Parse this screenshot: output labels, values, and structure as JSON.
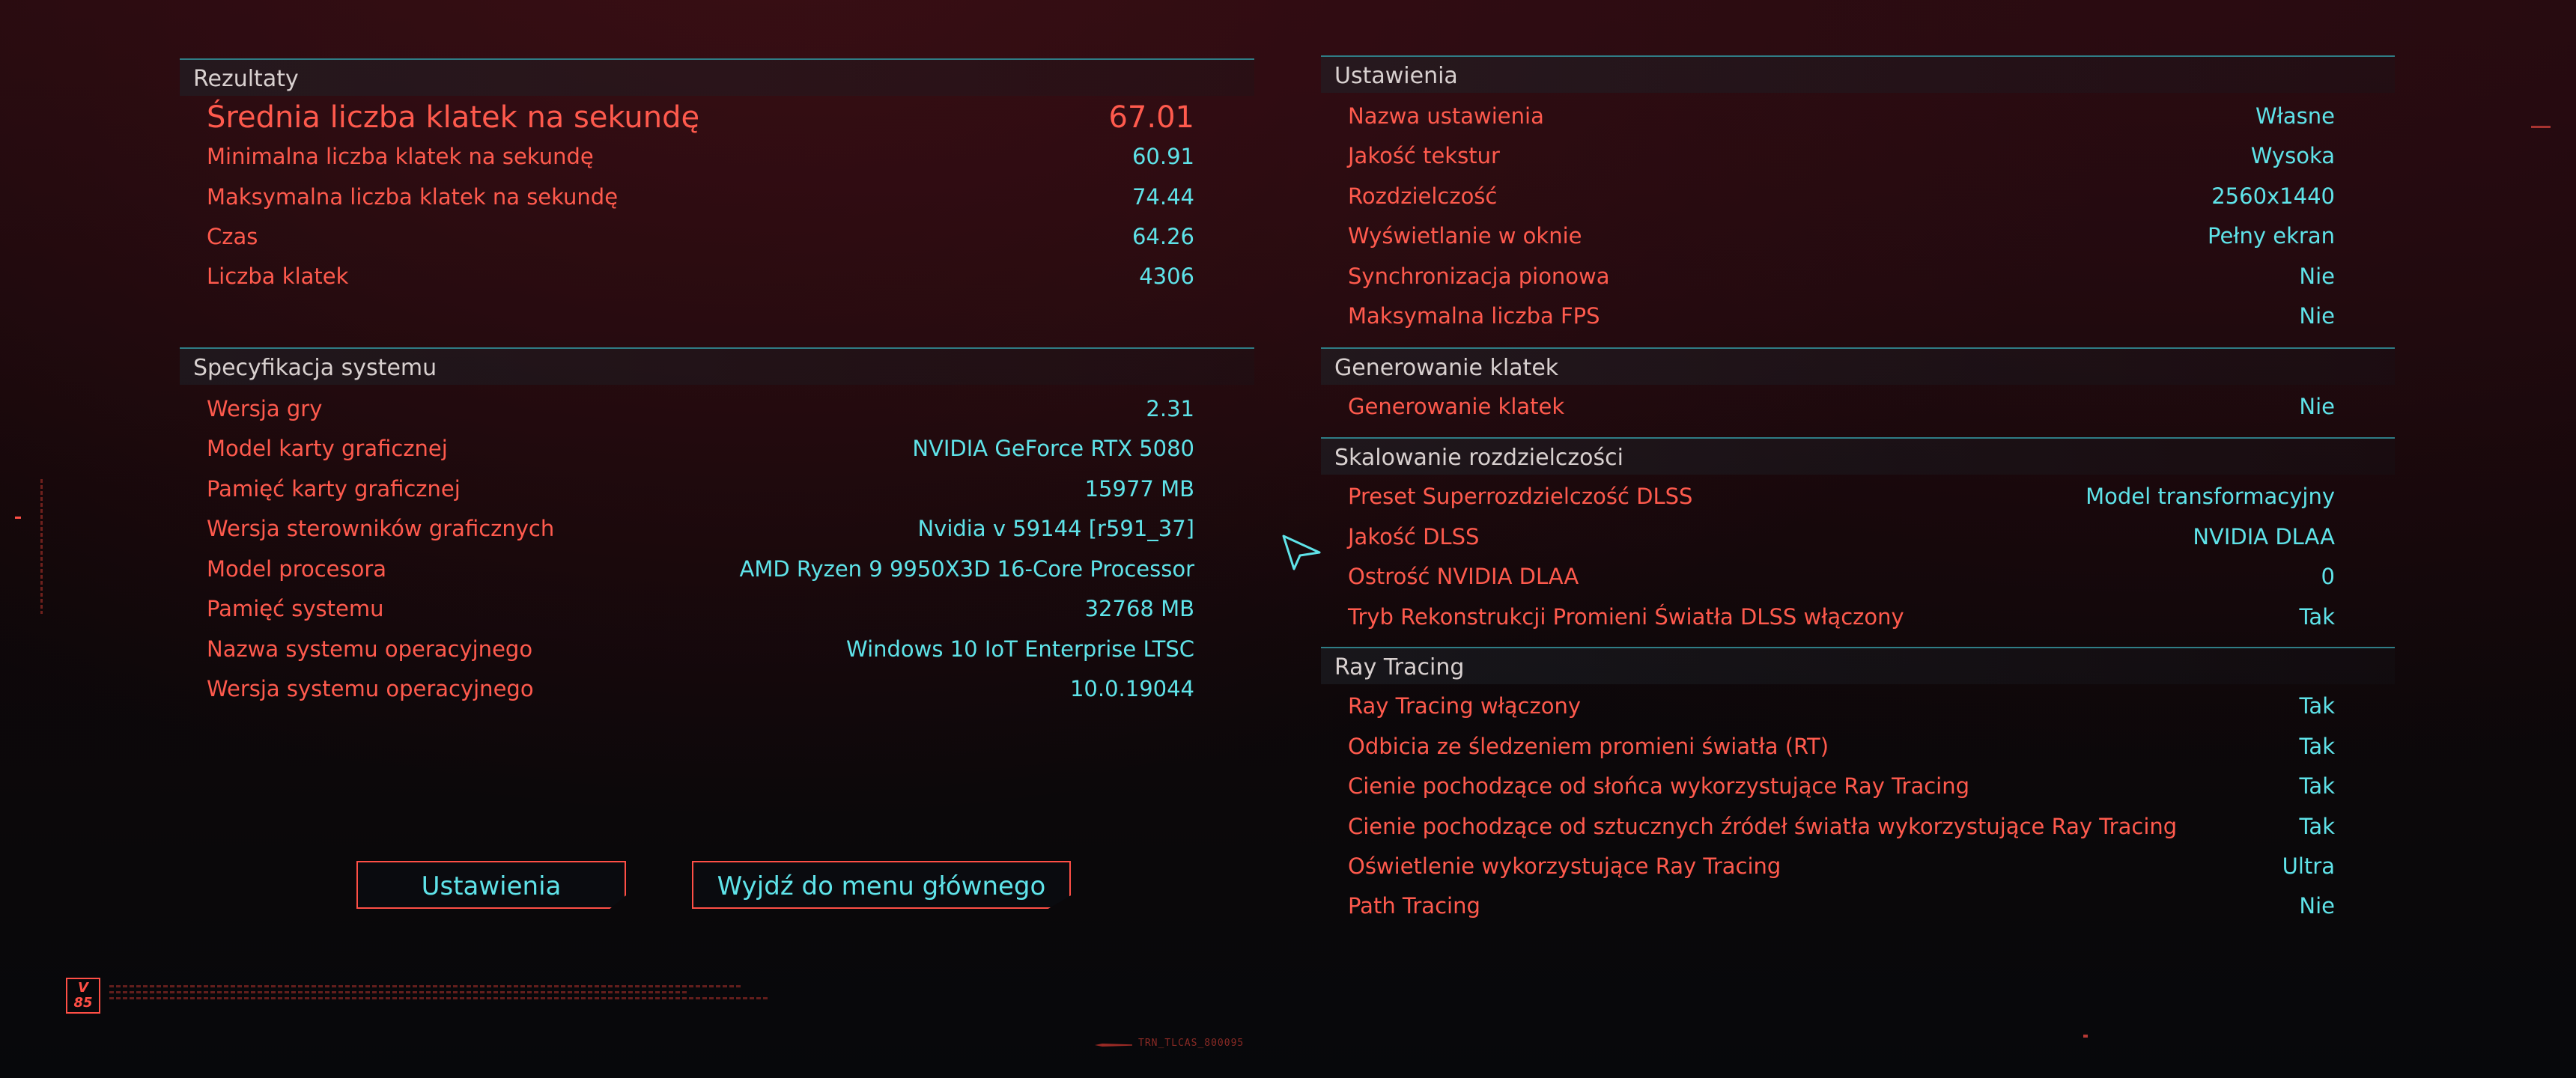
{
  "results": {
    "title": "Rezultaty",
    "rows": [
      {
        "label": "Średnia liczba klatek na sekundę",
        "value": "67.01"
      },
      {
        "label": "Minimalna liczba klatek na sekundę",
        "value": "60.91"
      },
      {
        "label": "Maksymalna liczba klatek na sekundę",
        "value": "74.44"
      },
      {
        "label": "Czas",
        "value": "64.26"
      },
      {
        "label": "Liczba klatek",
        "value": "4306"
      }
    ]
  },
  "system": {
    "title": "Specyfikacja systemu",
    "rows": [
      {
        "label": "Wersja gry",
        "value": "2.31"
      },
      {
        "label": "Model karty graficznej",
        "value": "NVIDIA GeForce RTX 5080"
      },
      {
        "label": "Pamięć karty graficznej",
        "value": "15977 MB"
      },
      {
        "label": "Wersja sterowników graficznych",
        "value": "Nvidia v 59144 [r591_37]"
      },
      {
        "label": "Model procesora",
        "value": "AMD Ryzen 9 9950X3D 16-Core Processor"
      },
      {
        "label": "Pamięć systemu",
        "value": "32768 MB"
      },
      {
        "label": "Nazwa systemu operacyjnego",
        "value": "Windows 10 IoT Enterprise LTSC"
      },
      {
        "label": "Wersja systemu operacyjnego",
        "value": "10.0.19044"
      }
    ]
  },
  "buttons": {
    "settings": "Ustawienia",
    "exit": "Wyjdź do menu głównego"
  },
  "settings": {
    "title": "Ustawienia",
    "rows": [
      {
        "label": "Nazwa ustawienia",
        "value": "Własne"
      },
      {
        "label": "Jakość tekstur",
        "value": "Wysoka"
      },
      {
        "label": "Rozdzielczość",
        "value": "2560x1440"
      },
      {
        "label": "Wyświetlanie w oknie",
        "value": "Pełny ekran"
      },
      {
        "label": "Synchronizacja pionowa",
        "value": "Nie"
      },
      {
        "label": "Maksymalna liczba FPS",
        "value": "Nie"
      }
    ]
  },
  "frame_gen": {
    "title": "Generowanie klatek",
    "rows": [
      {
        "label": "Generowanie klatek",
        "value": "Nie"
      }
    ]
  },
  "scaling": {
    "title": "Skalowanie rozdzielczości",
    "rows": [
      {
        "label": "Preset Superrozdzielczość DLSS",
        "value": "Model transformacyjny"
      },
      {
        "label": "Jakość DLSS",
        "value": "NVIDIA DLAA"
      },
      {
        "label": "Ostrość NVIDIA DLAA",
        "value": "0"
      },
      {
        "label": "Tryb Rekonstrukcji Promieni Światła DLSS włączony",
        "value": "Tak"
      }
    ]
  },
  "ray_tracing": {
    "title": "Ray Tracing",
    "rows": [
      {
        "label": "Ray Tracing włączony",
        "value": "Tak"
      },
      {
        "label": "Odbicia ze śledzeniem promieni światła (RT)",
        "value": "Tak"
      },
      {
        "label": "Cienie pochodzące od słońca wykorzystujące Ray Tracing",
        "value": "Tak"
      },
      {
        "label": "Cienie pochodzące od sztucznych źródeł światła wykorzystujące Ray Tracing",
        "value": "Tak"
      },
      {
        "label": "Oświetlenie wykorzystujące Ray Tracing",
        "value": "Ultra"
      },
      {
        "label": "Path Tracing",
        "value": "Nie"
      }
    ]
  },
  "footer": {
    "logo": "V\n85",
    "tag": "TRN_TLCAS_800095"
  },
  "colors": {
    "label": "#ff5a4d",
    "value": "#5fe3e9",
    "header": "#d8d0cf",
    "divider": "#2f7d86"
  }
}
